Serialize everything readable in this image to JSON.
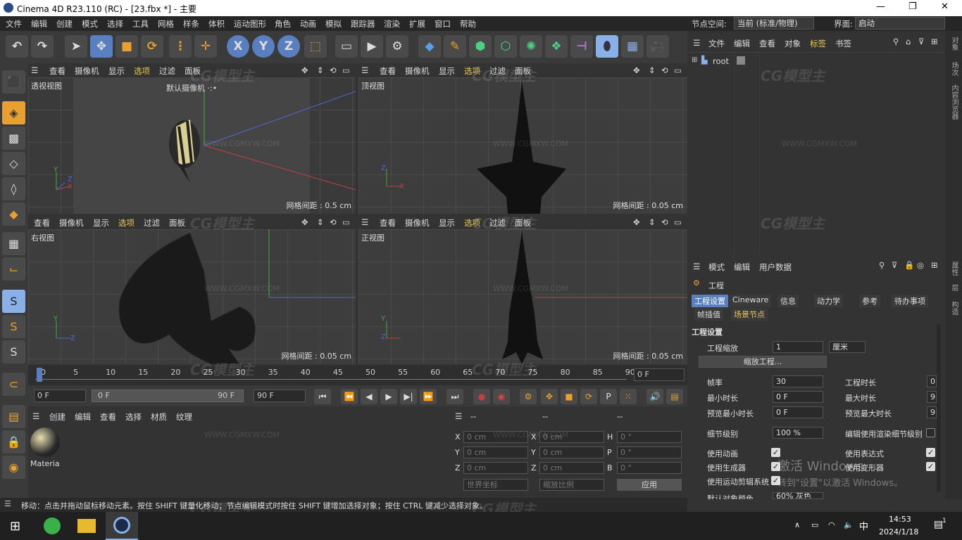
{
  "title": {
    "text": "Cinema 4D R23.110 (RC) - [23.fbx *] - 主要",
    "min": "—",
    "max": "❐",
    "close": "✕"
  },
  "menu": {
    "items": [
      "文件",
      "编辑",
      "创建",
      "模式",
      "选择",
      "工具",
      "网格",
      "样条",
      "体积",
      "运动图形",
      "角色",
      "动画",
      "模拟",
      "跟踪器",
      "渲染",
      "扩展",
      "窗口",
      "帮助"
    ],
    "node_space_label": "节点空间:",
    "node_space_value": "当前 (标准/物理)",
    "layout_label": "界面:",
    "layout_value": "启动"
  },
  "toolbar": {
    "x": "X",
    "y": "Y",
    "z": "Z"
  },
  "viewports": {
    "head": [
      "查看",
      "摄像机",
      "显示",
      "选项",
      "过滤",
      "面板"
    ],
    "tl": {
      "name": "透视视图",
      "camera": "默认摄像机 ·:•",
      "grid": "网格间距 : 0.5 cm"
    },
    "tr": {
      "name": "顶视图",
      "grid": "网格间距 : 0.05 cm"
    },
    "bl": {
      "name": "右视图",
      "grid": "网格间距 : 0.05 cm"
    },
    "br": {
      "name": "正视图",
      "grid": "网格间距 : 0.05 cm"
    }
  },
  "axes": {
    "x": "X",
    "y": "Y",
    "z": "Z"
  },
  "timeline": {
    "ticks": [
      "0",
      "5",
      "10",
      "15",
      "20",
      "25",
      "30",
      "35",
      "40",
      "45",
      "50",
      "55",
      "60",
      "65",
      "70",
      "75",
      "80",
      "85",
      "90"
    ],
    "end": "0 F"
  },
  "transport": {
    "start": "0 F",
    "range_start": "0 F",
    "range_end": "90 F",
    "end": "90 F"
  },
  "material": {
    "menu": [
      "创建",
      "编辑",
      "查看",
      "选择",
      "材质",
      "纹理"
    ],
    "item": "Materia"
  },
  "coord": {
    "head": [
      "--",
      "--",
      "--"
    ],
    "rows": [
      {
        "a": "X",
        "v1": "0 cm",
        "b": "X",
        "v2": "0 cm",
        "c": "H",
        "v3": "0 °"
      },
      {
        "a": "Y",
        "v1": "0 cm",
        "b": "Y",
        "v2": "0 cm",
        "c": "P",
        "v3": "0 °"
      },
      {
        "a": "Z",
        "v1": "0 cm",
        "b": "Z",
        "v2": "0 cm",
        "c": "B",
        "v3": "0 °"
      }
    ],
    "space": "世界坐标",
    "scale": "缩放比例",
    "apply": "应用"
  },
  "objmgr": {
    "menu": [
      "文件",
      "编辑",
      "查看",
      "对象",
      "标签",
      "书签"
    ],
    "root": "root"
  },
  "attr": {
    "menu": [
      "模式",
      "编辑",
      "用户数据"
    ],
    "section": "工程",
    "tabs": [
      "工程设置",
      "Cineware",
      "信息",
      "动力学",
      "参考",
      "待办事项"
    ],
    "tabs2": [
      "帧插值",
      "场景节点"
    ],
    "heading": "工程设置",
    "scale_label": "工程缩放",
    "scale_value": "1",
    "scale_unit": "厘米",
    "scale_btn": "缩放工程...",
    "fps_label": "帧率",
    "fps_value": "30",
    "time_label": "工程时长",
    "time_value": "0",
    "min_label": "最小时长",
    "min_value": "0 F",
    "max_label": "最大时长",
    "max_value": "9",
    "pmin_label": "预览最小时长",
    "pmin_value": "0 F",
    "pmax_label": "预览最大时长",
    "pmax_value": "9",
    "lod_label": "细节级别",
    "lod_value": "100 %",
    "lod_render": "编辑使用渲染细节级别",
    "anim": "使用动画",
    "expr": "使用表达式",
    "gen": "使用生成器",
    "deform": "使用变形器",
    "motion": "使用运动剪辑系统",
    "defcolor": "默认对象颜色",
    "defcolor_value": "60% 灰色"
  },
  "rightstrip": [
    "对象",
    "场次",
    "内容浏览器",
    "属性",
    "层",
    "构造"
  ],
  "status": "移动：点击并拖动鼠标移动元素。按住 SHIFT 键量化移动；节点编辑模式时按住 SHIFT 键增加选择对象；按住 CTRL 键减少选择对象。",
  "activation": {
    "line1": "激活 Windows",
    "line2": "转到\"设置\"以激活 Windows。"
  },
  "taskbar": {
    "ime": "中",
    "time": "14:53",
    "date": "2024/1/18",
    "notify": "1"
  },
  "watermark": {
    "logo": "CG模型主",
    "url": "WWW.CGMXW.COM"
  }
}
